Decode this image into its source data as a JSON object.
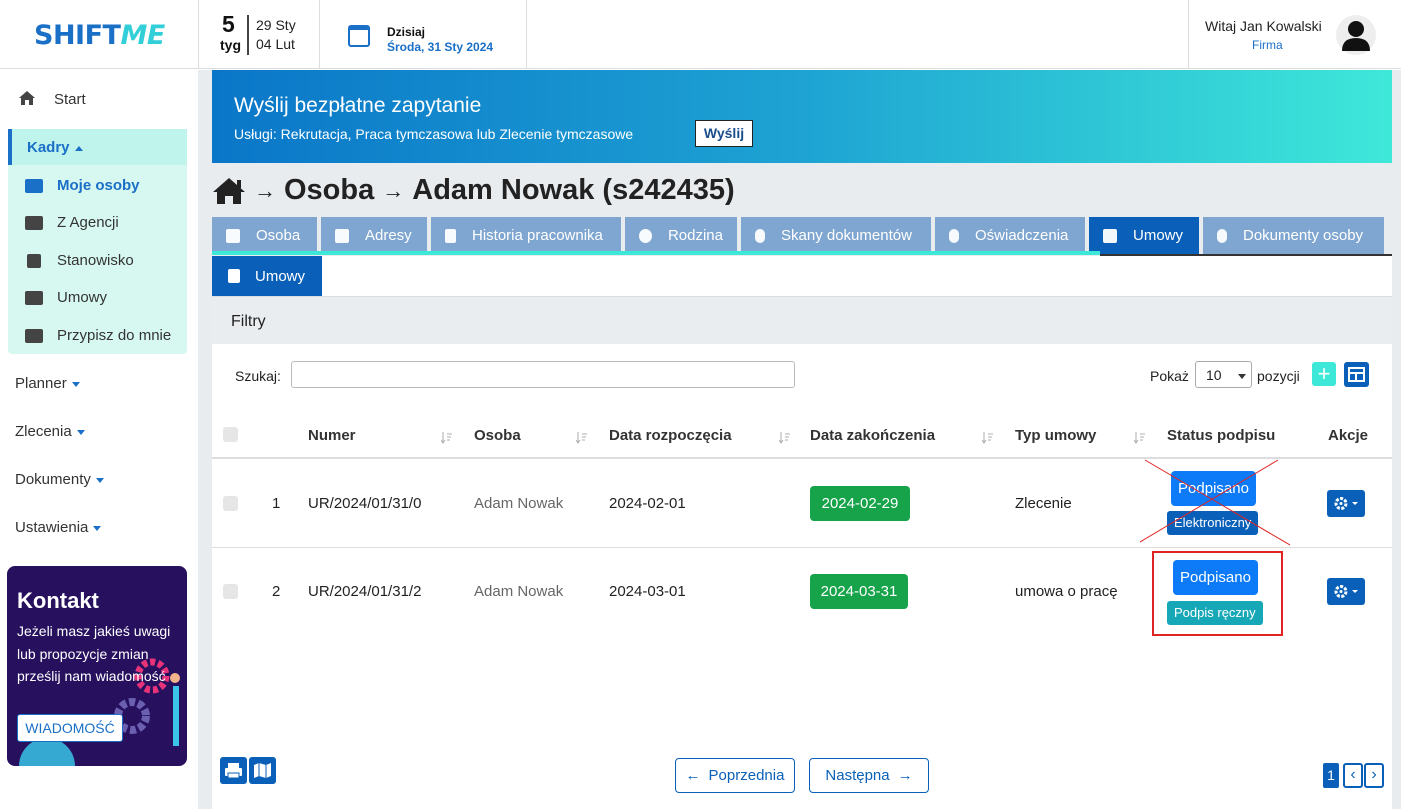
{
  "brand": {
    "logo_part1": "SHIFT",
    "logo_part2": "ME"
  },
  "week": {
    "number": "5",
    "label": "tyg",
    "start": "29 Sty",
    "end": "04 Lut"
  },
  "today": {
    "label": "Dzisiaj",
    "date": "Środa, 31 Sty 2024"
  },
  "user": {
    "greeting": "Witaj Jan Kowalski",
    "company": "Firma"
  },
  "sidebar": {
    "start": "Start",
    "kadry": "Kadry",
    "kadry_items": [
      "Moje osoby",
      "Z Agencji",
      "Stanowisko",
      "Umowy",
      "Przypisz do mnie"
    ],
    "planner": "Planner",
    "zlecenia": "Zlecenia",
    "dokumenty": "Dokumenty",
    "ustawienia": "Ustawienia"
  },
  "contact": {
    "title": "Kontakt",
    "text": "Jeżeli masz jakieś uwagi lub propozycje zmian prześlij nam wiadomość",
    "button": "WIADOMOŚĆ"
  },
  "banner": {
    "title": "Wyślij bezpłatne zapytanie",
    "subtitle": "Usługi: Rekrutacja, Praca tymczasowa lub Zlecenie tymczasowe",
    "button": "Wyślij"
  },
  "breadcrumb": {
    "arrow": "→",
    "section": "Osoba",
    "name": "Adam Nowak (s242435)"
  },
  "tabs": [
    "Osoba",
    "Adresy",
    "Historia pracownika",
    "Rodzina",
    "Skany dokumentów",
    "Oświadczenia",
    "Umowy",
    "Dokumenty osoby"
  ],
  "active_tab": "Umowy",
  "subtab": "Umowy",
  "filters": {
    "title": "Filtry",
    "search_label": "Szukaj:",
    "show_label": "Pokaż",
    "page_size": "10",
    "items_label": "pozycji",
    "add": "+"
  },
  "table": {
    "headers": [
      "Numer",
      "Osoba",
      "Data rozpoczęcia",
      "Data zakończenia",
      "Typ umowy",
      "Status podpisu",
      "Akcje"
    ],
    "rows": [
      {
        "lp": "1",
        "numer": "UR/2024/01/31/0",
        "osoba": "Adam Nowak",
        "start": "2024-02-01",
        "end": "2024-02-29",
        "typ": "Zlecenie",
        "status": "Podpisano",
        "podpis": "Elektroniczny"
      },
      {
        "lp": "2",
        "numer": "UR/2024/01/31/2",
        "osoba": "Adam Nowak",
        "start": "2024-03-01",
        "end": "2024-03-31",
        "typ": "umowa o pracę",
        "status": "Podpisano",
        "podpis": "Podpis ręczny"
      }
    ]
  },
  "pagination": {
    "prev": "Poprzednia",
    "next": "Następna",
    "page": "1",
    "prev_sym": "‹",
    "next_sym": "›"
  },
  "colors": {
    "primary": "#0a60b8",
    "accent": "#3ee8d9",
    "success": "#16a34a",
    "signed": "#0d7bf7",
    "annotation": "#e02424"
  }
}
